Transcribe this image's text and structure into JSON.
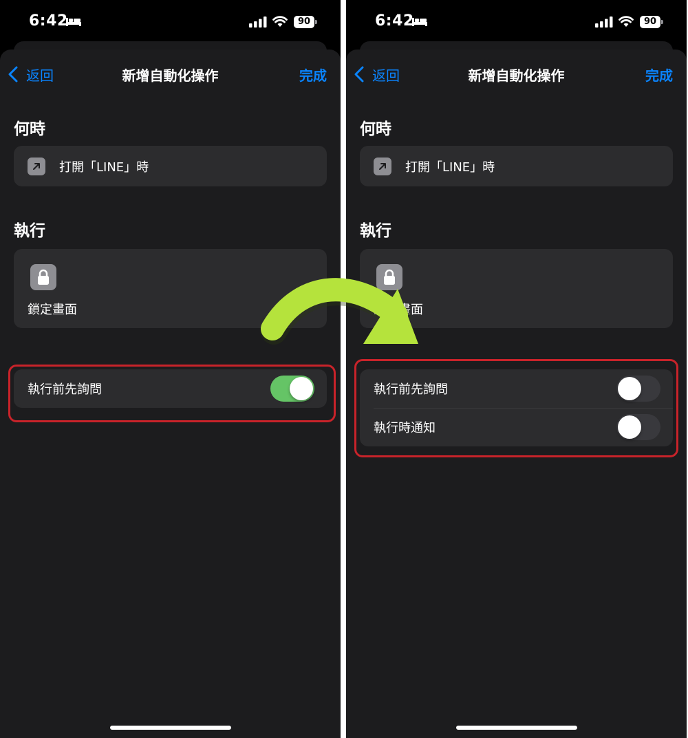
{
  "colors": {
    "accent": "#0a84ff",
    "toggle_on": "#65c466",
    "toggle_off": "#39393d",
    "highlight": "#c8232a",
    "arrow": "#b5e33c"
  },
  "screens": [
    {
      "status": {
        "time": "6:42",
        "battery": "90"
      },
      "nav": {
        "back": "返回",
        "title": "新增自動化操作",
        "done": "完成"
      },
      "when": {
        "heading": "何時",
        "trigger": "打開「LINE」時"
      },
      "do": {
        "heading": "執行",
        "action": "鎖定畫面"
      },
      "options": [
        {
          "label": "執行前先詢問",
          "enabled": true
        }
      ]
    },
    {
      "status": {
        "time": "6:42",
        "battery": "90"
      },
      "nav": {
        "back": "返回",
        "title": "新增自動化操作",
        "done": "完成"
      },
      "when": {
        "heading": "何時",
        "trigger": "打開「LINE」時"
      },
      "do": {
        "heading": "執行",
        "action": "鎖定畫面"
      },
      "options": [
        {
          "label": "執行前先詢問",
          "enabled": false
        },
        {
          "label": "執行時通知",
          "enabled": false
        }
      ]
    }
  ]
}
